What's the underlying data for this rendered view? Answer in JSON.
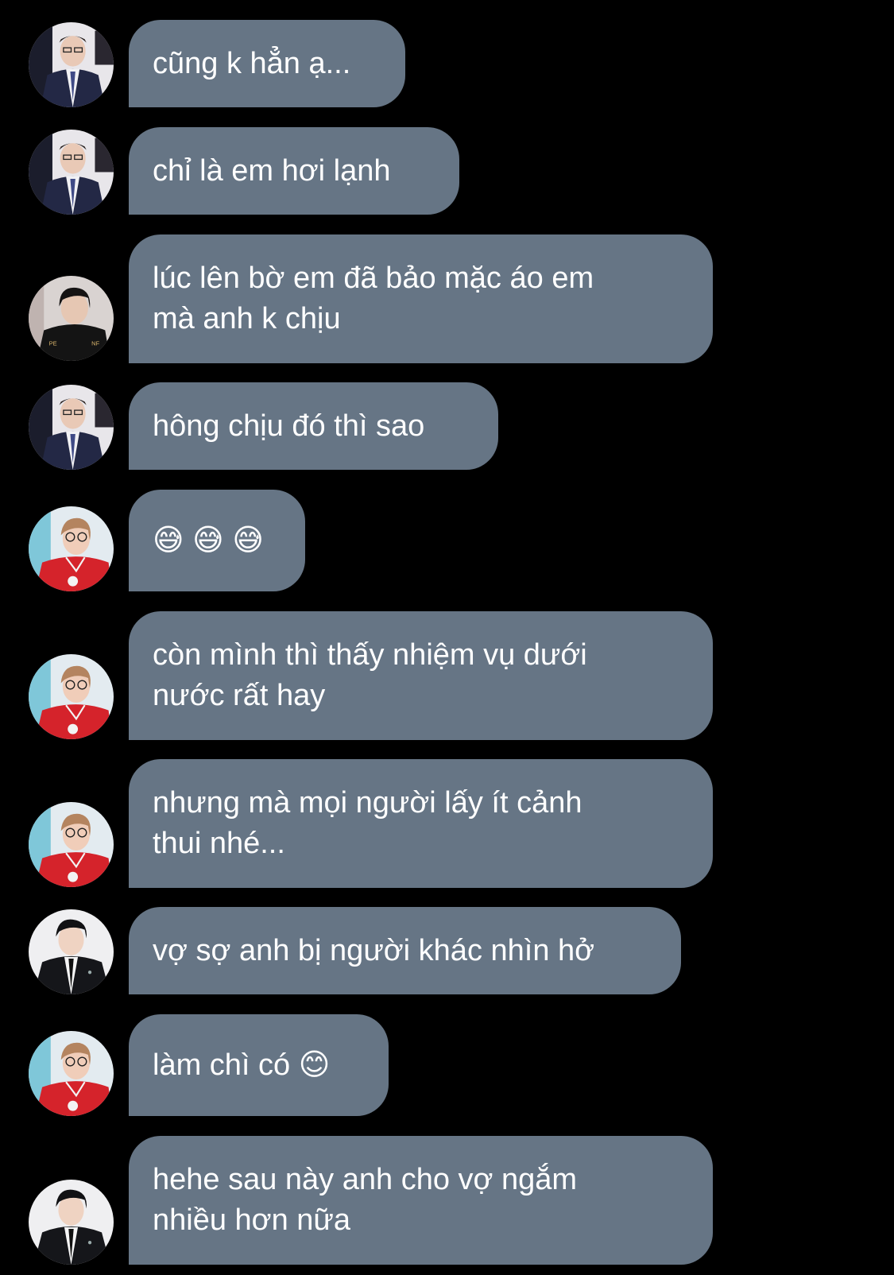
{
  "chat": {
    "messages": [
      {
        "avatar": "avatar-suit-boy-photo",
        "text": "cũng k hẳn ạ..."
      },
      {
        "avatar": "avatar-suit-boy-photo",
        "text": "chỉ là em hơi lạnh"
      },
      {
        "avatar": "avatar-black-jacket-photo",
        "text": "lúc lên bờ em đã bảo mặc áo em\nmà anh k chịu"
      },
      {
        "avatar": "avatar-suit-boy-photo",
        "text": "hông chịu đó thì sao"
      },
      {
        "avatar": "avatar-red-jersey-photo",
        "text": "😅 😅 😅"
      },
      {
        "avatar": "avatar-red-jersey-photo",
        "text": "còn mình thì thấy nhiệm vụ dưới\nnước rất hay"
      },
      {
        "avatar": "avatar-red-jersey-photo",
        "text": "nhưng mà mọi người lấy ít cảnh\nthui nhé..."
      },
      {
        "avatar": "avatar-dark-suit-photo",
        "text": "vợ sợ anh bị người khác nhìn hở"
      },
      {
        "avatar": "avatar-red-jersey-photo",
        "text": "làm chì có 😊"
      },
      {
        "avatar": "avatar-dark-suit-photo",
        "text": "hehe sau này anh cho vợ ngắm\nnhiều hơn nữa"
      }
    ]
  },
  "colors": {
    "background": "#000000",
    "bubble": "#667585",
    "text": "#ffffff"
  }
}
